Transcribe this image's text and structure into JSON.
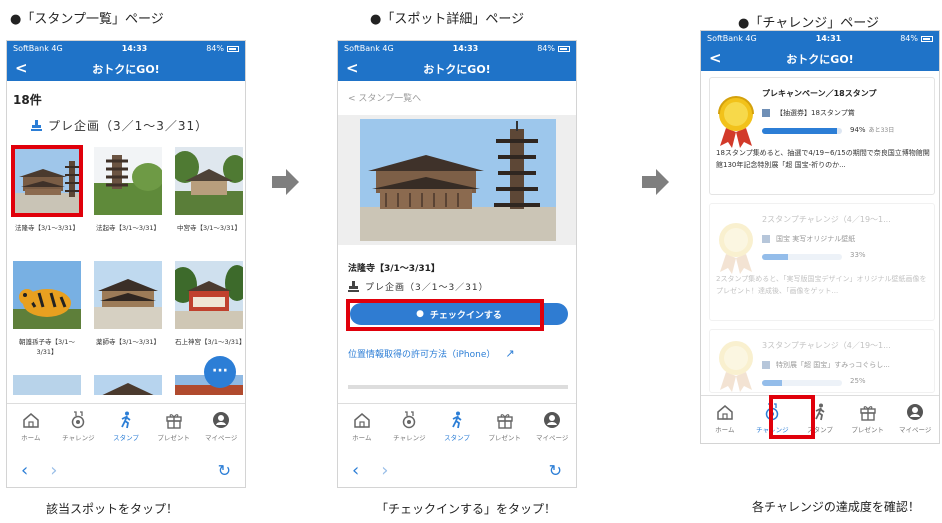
{
  "screen1": {
    "section_title": "●「スタンプ一覧」ページ",
    "status": {
      "carrier": "SoftBank 4G",
      "time": "14:33",
      "battery": "84%"
    },
    "nav_title": "おトクにGO!",
    "count": "18件",
    "plan": "プレ企画（3／1～3／31）",
    "spots": [
      {
        "caption": "法隆寺【3/1～3/31】"
      },
      {
        "caption": "法起寺【3/1～3/31】"
      },
      {
        "caption": "中宮寺【3/1～3/31】"
      },
      {
        "caption": "朝護孫子寺【3/1～3/31】"
      },
      {
        "caption": "薬師寺【3/1～3/31】"
      },
      {
        "caption": "石上神宮【3/1～3/31】"
      }
    ],
    "fab": "···",
    "caption": "該当スポットをタップ！"
  },
  "screen2": {
    "section_title": "●「スポット詳細」ページ",
    "status": {
      "carrier": "SoftBank 4G",
      "time": "14:33",
      "battery": "84%"
    },
    "nav_title": "おトクにGO!",
    "backlink": "< スタンプ一覧へ",
    "spot_title": "法隆寺【3/1～3/31】",
    "plan": "プレ企画（3／1～3／31）",
    "checkin": "チェックインする",
    "permission_link": "位置情報取得の許可方法（iPhone）",
    "caption": "「チェックインする」をタップ！"
  },
  "screen3": {
    "section_title": "●「チャレンジ」ページ",
    "status": {
      "carrier": "SoftBank 4G",
      "time": "14:31",
      "battery": "84%"
    },
    "nav_title": "おトクにGO!",
    "cards": [
      {
        "title": "プレキャンペーン／18スタンプ",
        "prize": "【抽選券】18スタンプ賞",
        "progress": 94,
        "percent": "94%",
        "days": "あと33日",
        "desc": "18スタンプ集めると、抽選で4/19~6/15の期間で奈良国立博物館開館130年記念特別展「超 国宝-祈りのか..."
      },
      {
        "title": "2スタンプチャレンジ（4／19～1...",
        "prize": "国宝 実写オリジナル壁紙",
        "progress": 33,
        "percent": "33%",
        "days": "",
        "desc": "2スタンプ集めると、「実写版国宝デザイン」オリジナル壁紙画像をプレゼント！達成後、「画像をゲット..."
      },
      {
        "title": "3スタンプチャレンジ（4／19～1...",
        "prize": "特別展「超 国宝」すみっコぐらし...",
        "progress": 25,
        "percent": "25%",
        "days": "",
        "desc": ""
      }
    ],
    "caption": "各チャレンジの達成度を確認！"
  },
  "tabs": [
    {
      "label": "ホーム",
      "icon": "home-icon"
    },
    {
      "label": "チャレンジ",
      "icon": "medal-icon"
    },
    {
      "label": "スタンプ",
      "icon": "walker-icon"
    },
    {
      "label": "プレゼント",
      "icon": "gift-icon"
    },
    {
      "label": "マイページ",
      "icon": "user-icon"
    }
  ],
  "colors": {
    "brand_blue": "#1f73c8",
    "accent_blue": "#2c7ed6",
    "highlight_red": "#e0000b"
  }
}
